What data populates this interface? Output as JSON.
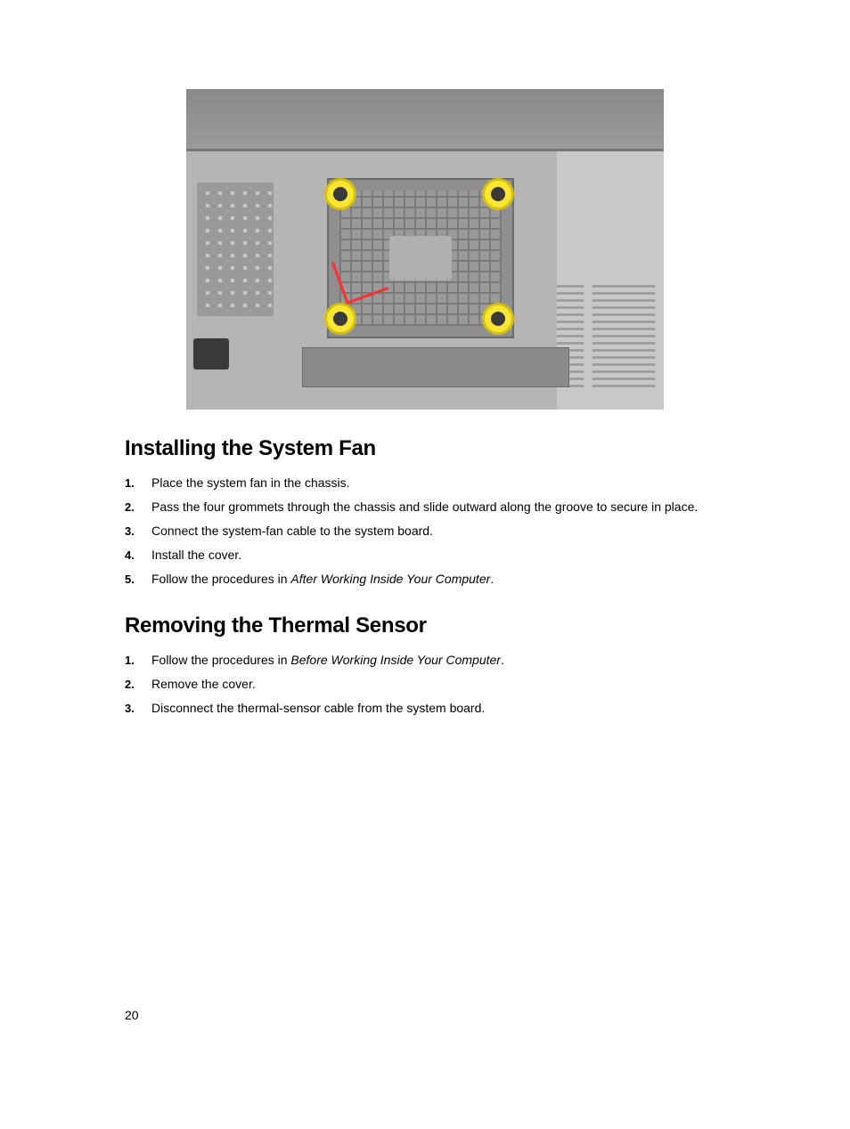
{
  "figure": {
    "alt": "Rear view of computer chassis highlighting four yellow grommets around the system fan frame"
  },
  "section1": {
    "heading": "Installing the System Fan",
    "steps": [
      {
        "num": "1.",
        "text": "Place the system fan in the chassis."
      },
      {
        "num": "2.",
        "text": "Pass the four grommets through the chassis and slide outward along the groove to secure in place."
      },
      {
        "num": "3.",
        "text": "Connect the system-fan cable to the system board."
      },
      {
        "num": "4.",
        "text": "Install the cover."
      },
      {
        "num": "5.",
        "text_pre": "Follow the procedures in ",
        "text_italic": "After Working Inside Your Computer",
        "text_post": "."
      }
    ]
  },
  "section2": {
    "heading": "Removing the Thermal Sensor",
    "steps": [
      {
        "num": "1.",
        "text_pre": "Follow the procedures in ",
        "text_italic": "Before Working Inside Your Computer",
        "text_post": "."
      },
      {
        "num": "2.",
        "text": "Remove the cover."
      },
      {
        "num": "3.",
        "text": "Disconnect the thermal-sensor cable from the system board."
      }
    ]
  },
  "page_number": "20"
}
